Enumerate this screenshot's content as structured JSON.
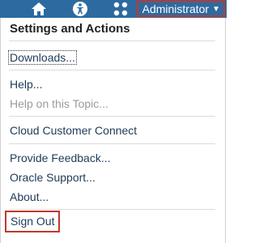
{
  "topbar": {
    "icons": [
      "home-icon",
      "accessibility-icon",
      "apps-grid-icon"
    ],
    "user_menu_label": "Administrator",
    "bar_color": "#2d6aa0",
    "highlight_color": "#c0392b"
  },
  "menu": {
    "heading": "Settings and Actions",
    "items": [
      {
        "label": "Downloads...",
        "state": "focused"
      },
      {
        "label": "Help...",
        "state": "enabled"
      },
      {
        "label": "Help on this Topic...",
        "state": "disabled"
      },
      {
        "label": "Cloud Customer Connect",
        "state": "enabled"
      },
      {
        "label": "Provide Feedback...",
        "state": "enabled"
      },
      {
        "label": "Oracle Support...",
        "state": "enabled"
      },
      {
        "label": "About...",
        "state": "enabled"
      },
      {
        "label": "Sign Out",
        "state": "highlighted"
      }
    ]
  }
}
